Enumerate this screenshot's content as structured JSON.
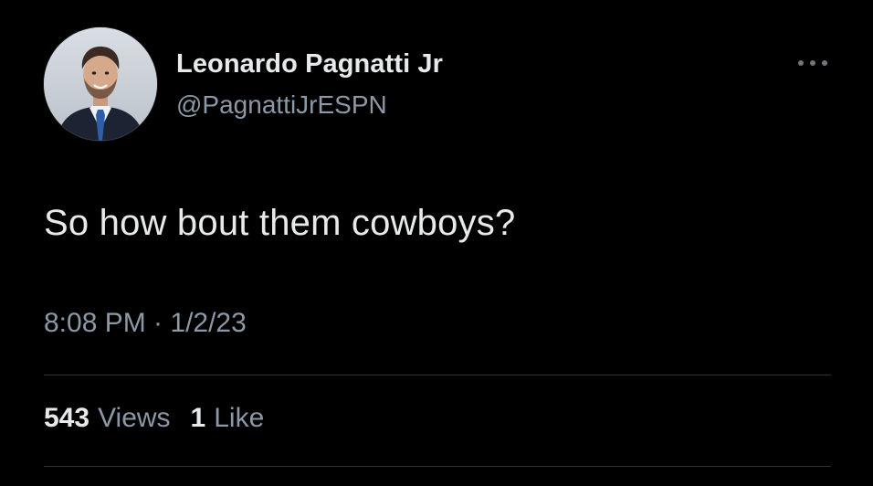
{
  "author": {
    "display_name": "Leonardo Pagnatti Jr",
    "handle": "@PagnattiJrESPN"
  },
  "tweet": {
    "text": "So how bout them cowboys?",
    "timestamp": "8:08 PM · 1/2/23"
  },
  "stats": {
    "views_count": "543",
    "views_label": "Views",
    "likes_count": "1",
    "likes_label": "Like"
  },
  "icons": {
    "more": "more-horizontal-icon"
  },
  "colors": {
    "background": "#000000",
    "primary_text": "#e7e9ea",
    "secondary_text": "#8b98a5",
    "divider": "#2f3336"
  }
}
